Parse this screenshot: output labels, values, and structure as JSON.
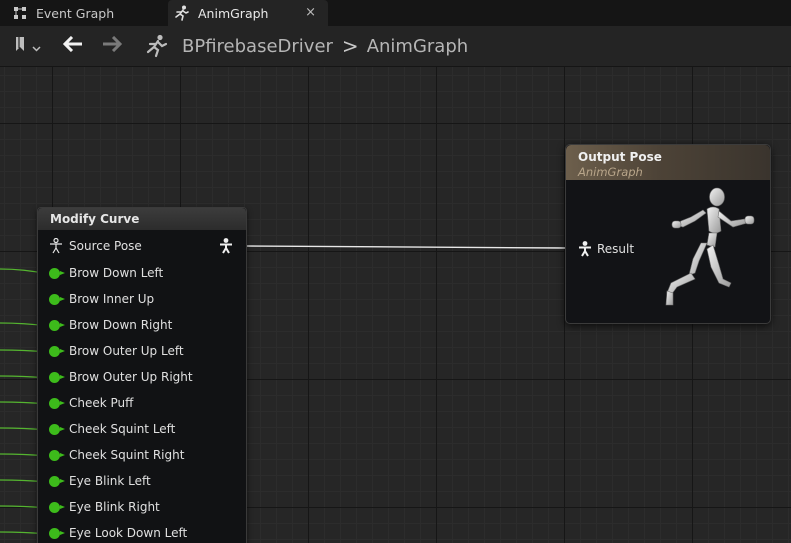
{
  "tabs": [
    {
      "label": "Event Graph",
      "icon": "event-graph-icon"
    },
    {
      "label": "AnimGraph",
      "icon": "anim-runner-icon",
      "close": "×"
    }
  ],
  "toolbar": {
    "breadcrumb": [
      "BPfirebaseDriver",
      "AnimGraph"
    ],
    "separator": ">"
  },
  "modify_node": {
    "title": "Modify Curve",
    "source_pose": "Source Pose",
    "pins": [
      "Brow Down Left",
      "Brow Inner Up",
      "Brow Down Right",
      "Brow Outer Up Left",
      "Brow Outer Up Right",
      "Cheek Puff",
      "Cheek Squint Left",
      "Cheek Squint Right",
      "Eye Blink Left",
      "Eye Blink Right",
      "Eye Look Down Left"
    ]
  },
  "output_node": {
    "title": "Output Pose",
    "subtitle": "AnimGraph",
    "result_label": "Result"
  },
  "colors": {
    "float_pin": "#3dbb1b",
    "output_header": "#6d5f4c",
    "graph_bg": "#262626"
  }
}
